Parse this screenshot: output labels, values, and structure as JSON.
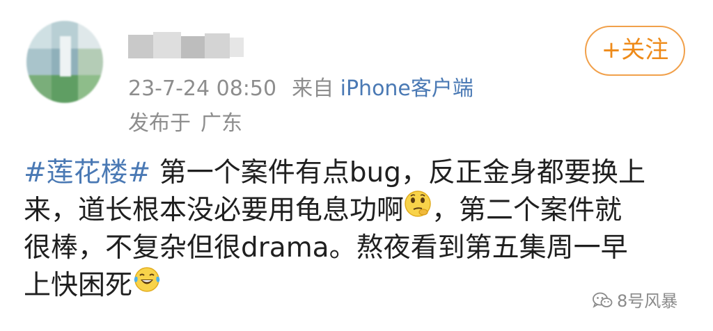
{
  "post": {
    "timestamp": "23-7-24 08:50",
    "from_label": "来自",
    "source": "iPhone客户端",
    "location_prefix": "发布于",
    "location": "广东",
    "follow_label": "+关注",
    "hashtag": "#莲花楼#",
    "line1_text": " 第一个案件有点bug，反正金身都要换上",
    "line2_text": "来，道长根本没必要用龟息功啊",
    "line2_suffix": "，第二个案件就",
    "line3_text": "很棒，不复杂但很drama。熬夜看到第五集周一早",
    "line4_text": "上快困死"
  },
  "icons": {
    "thinking_emoji": "thinking-face-icon",
    "laughing_emoji": "laughing-crying-face-icon",
    "wechat_logo": "wechat-icon"
  },
  "watermark": {
    "text": "8号风暴"
  },
  "colors": {
    "link_blue": "#4a79b4",
    "follow_orange": "#ee8a18",
    "meta_gray": "#8d8d8d"
  }
}
